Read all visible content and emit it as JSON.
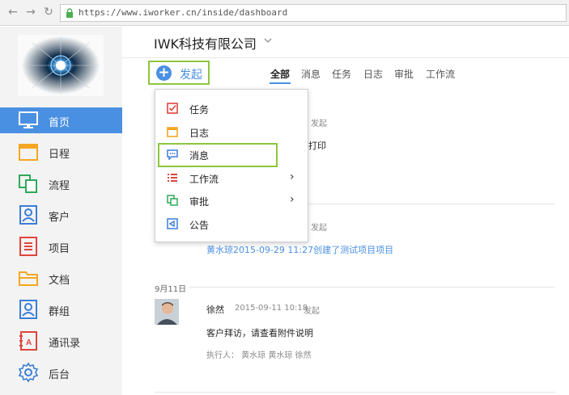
{
  "browser": {
    "url": "https://www.iworker.cn/inside/dashboard"
  },
  "company": {
    "name": "IWK科技有限公司"
  },
  "sidebar": {
    "items": [
      {
        "label": "首页",
        "icon": "monitor-icon",
        "active": true
      },
      {
        "label": "日程",
        "icon": "calendar-icon"
      },
      {
        "label": "流程",
        "icon": "workflow-icon"
      },
      {
        "label": "客户",
        "icon": "customer-icon"
      },
      {
        "label": "项目",
        "icon": "project-icon"
      },
      {
        "label": "文档",
        "icon": "folder-icon"
      },
      {
        "label": "群组",
        "icon": "group-icon"
      },
      {
        "label": "通讯录",
        "icon": "contacts-icon"
      },
      {
        "label": "后台",
        "icon": "gear-icon"
      }
    ]
  },
  "launch": {
    "label": "发起"
  },
  "tabs": [
    "全部",
    "消息",
    "任务",
    "日志",
    "审批",
    "工作流"
  ],
  "dropdown": {
    "items": [
      {
        "label": "任务",
        "icon": "task-icon"
      },
      {
        "label": "日志",
        "icon": "log-icon"
      },
      {
        "label": "消息",
        "icon": "message-icon",
        "highlighted": true
      },
      {
        "label": "工作流",
        "icon": "workflow-icon",
        "submenu": true
      },
      {
        "label": "审批",
        "icon": "approval-icon",
        "submenu": true
      },
      {
        "label": "公告",
        "icon": "announcement-icon"
      }
    ]
  },
  "feed": {
    "partial_1": {
      "action": "发起",
      "text": "打印"
    },
    "partial_2": {
      "action": "发起",
      "link": "黄水琼2015-09-29 11:27创建了测试项目项目"
    },
    "date_group": "9月11日",
    "post": {
      "author": "徐然",
      "time": "2015-09-11 10:18",
      "action": "发起",
      "content": "客户拜访，请查看附件说明",
      "executors": "执行人：  黄水琼  黄水琼  徐然"
    }
  },
  "colors": {
    "accent": "#4a90e2",
    "highlight": "#8dc63f",
    "sidebar_bg": "#f3f3f3"
  }
}
